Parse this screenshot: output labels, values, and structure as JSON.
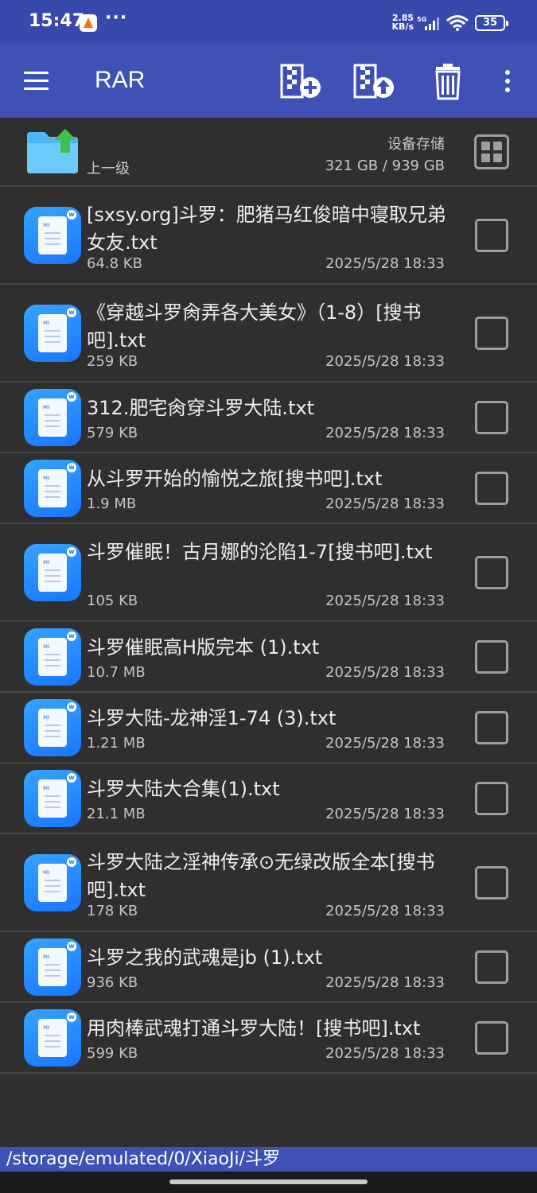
{
  "status_bar": {
    "time": "15:47",
    "more": "···",
    "speed_value": "2.85",
    "speed_unit": "KB/s",
    "network": "5G",
    "battery": "35"
  },
  "toolbar": {
    "title": "RAR",
    "actions": [
      "add-archive-icon",
      "extract-archive-icon",
      "delete-icon",
      "more-vert-icon"
    ]
  },
  "parent_row": {
    "label": "上一级",
    "storage_label": "设备存储",
    "storage_value": "321 GB / 939 GB"
  },
  "files": [
    {
      "name": "[sxsy.org]斗罗：肥猪马红俊暗中寝取兄弟女友.txt",
      "size": "64.8 KB",
      "date": "2025/5/28 18:33"
    },
    {
      "name": "《穿越斗罗肏弄各大美女》（1-8）[搜书吧].txt",
      "size": "259 KB",
      "date": "2025/5/28 18:33"
    },
    {
      "name": "312.肥宅肏穿斗罗大陆.txt",
      "size": "579 KB",
      "date": "2025/5/28 18:33"
    },
    {
      "name": "从斗罗开始的愉悦之旅[搜书吧].txt",
      "size": "1.9 MB",
      "date": "2025/5/28 18:33"
    },
    {
      "name": "斗罗催眠！古月娜的沦陷1-7[搜书吧].txt",
      "size": "105 KB",
      "date": "2025/5/28 18:33"
    },
    {
      "name": "斗罗催眠高H版完本 (1).txt",
      "size": "10.7 MB",
      "date": "2025/5/28 18:33"
    },
    {
      "name": "斗罗大陆-龙神淫1-74 (3).txt",
      "size": "1.21 MB",
      "date": "2025/5/28 18:33"
    },
    {
      "name": "斗罗大陆大合集(1).txt",
      "size": "21.1 MB",
      "date": "2025/5/28 18:33"
    },
    {
      "name": "斗罗大陆之淫神传承⊙无绿改版全本[搜书吧].txt",
      "size": "178 KB",
      "date": "2025/5/28 18:33"
    },
    {
      "name": "斗罗之我的武魂是jb (1).txt",
      "size": "936 KB",
      "date": "2025/5/28 18:33"
    },
    {
      "name": "用肉棒武魂打通斗罗大陆！[搜书吧].txt",
      "size": "599 KB",
      "date": "2025/5/28 18:33"
    }
  ],
  "path": "/storage/emulated/0/XiaoJi/斗罗",
  "colors": {
    "toolbar": "#3f51b5",
    "status_bar": "#3949ab",
    "background": "#2f2f2f",
    "file_icon": "#1e88e5",
    "folder_icon": "#4fc3f7",
    "folder_arrow": "#4caf50"
  }
}
